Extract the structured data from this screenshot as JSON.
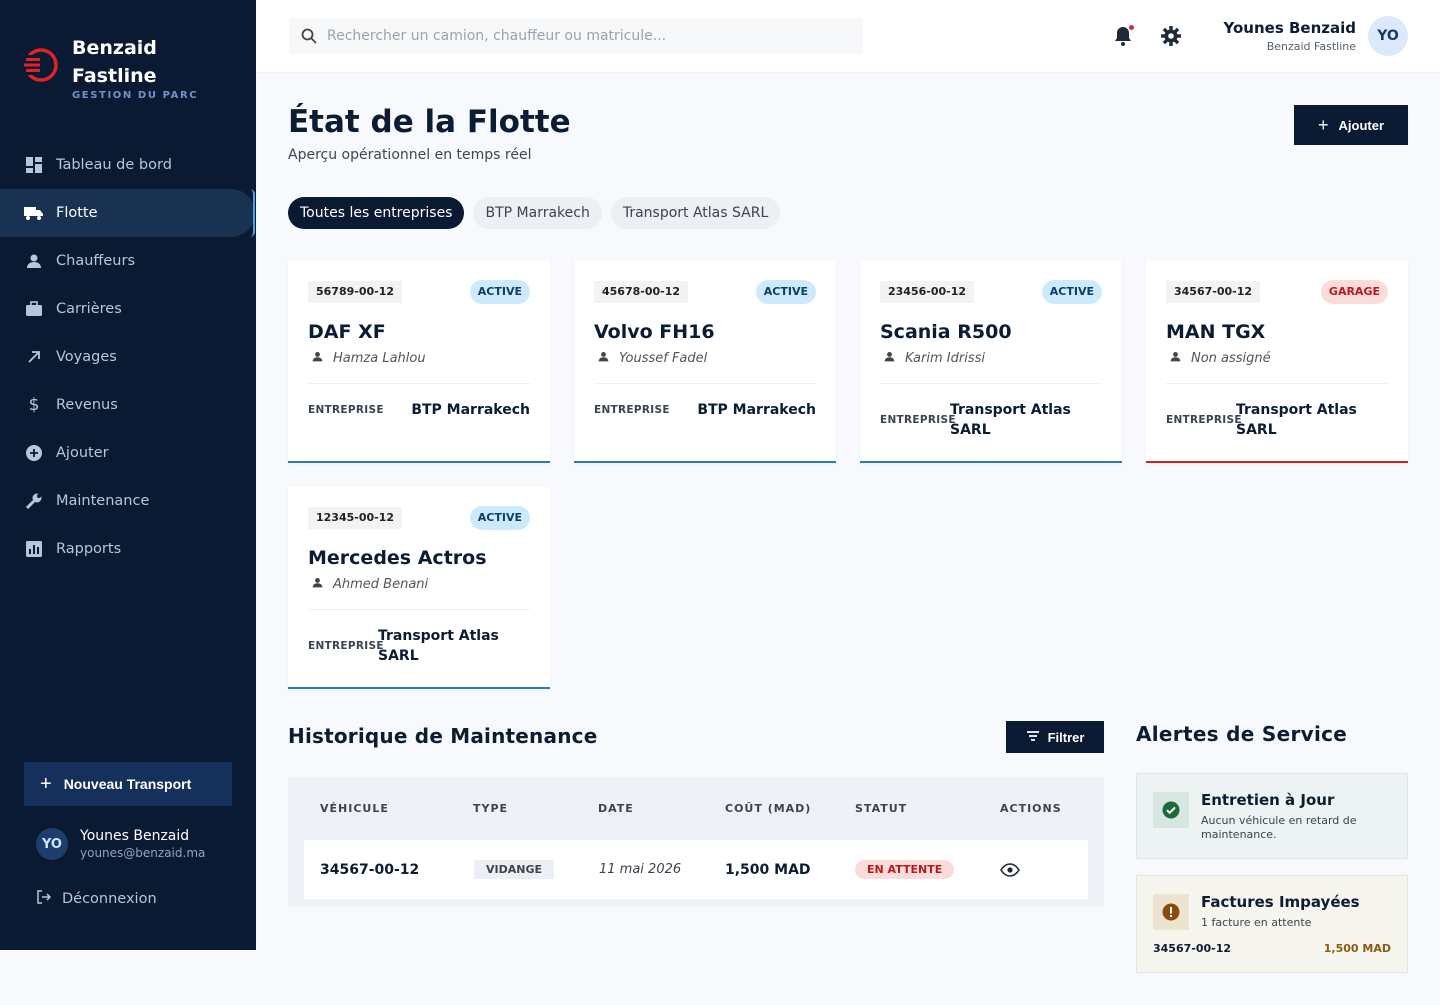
{
  "brand": {
    "name_line1": "Benzaid",
    "name_line2": "Fastline",
    "subtitle": "GESTION DU PARC",
    "accent": "#e02424"
  },
  "sidebar": {
    "items": [
      {
        "label": "Tableau de bord",
        "icon": "dashboard-icon",
        "active": false
      },
      {
        "label": "Flotte",
        "icon": "truck-icon",
        "active": true
      },
      {
        "label": "Chauffeurs",
        "icon": "person-icon",
        "active": false
      },
      {
        "label": "Carrières",
        "icon": "briefcase-icon",
        "active": false
      },
      {
        "label": "Voyages",
        "icon": "arrow-up-right-icon",
        "active": false
      },
      {
        "label": "Revenus",
        "icon": "dollar-icon",
        "active": false
      },
      {
        "label": "Ajouter",
        "icon": "plus-circle-icon",
        "active": false
      },
      {
        "label": "Maintenance",
        "icon": "wrench-icon",
        "active": false
      },
      {
        "label": "Rapports",
        "icon": "bar-chart-icon",
        "active": false
      }
    ],
    "new_transport_label": "Nouveau Transport",
    "user": {
      "initials": "YO",
      "name": "Younes Benzaid",
      "email": "younes@benzaid.ma"
    },
    "logout_label": "Déconnexion"
  },
  "topbar": {
    "search_placeholder": "Rechercher un camion, chauffeur ou matricule...",
    "user": {
      "name": "Younes Benzaid",
      "company": "Benzaid Fastline",
      "initials": "YO"
    }
  },
  "header": {
    "title": "État de la Flotte",
    "subtitle": "Aperçu opérationnel en temps réel",
    "add_label": "Ajouter"
  },
  "filters": [
    {
      "label": "Toutes les entreprises",
      "active": true
    },
    {
      "label": "BTP Marrakech",
      "active": false
    },
    {
      "label": "Transport Atlas SARL",
      "active": false
    }
  ],
  "trucks": [
    {
      "plate": "56789-00-12",
      "status": "ACTIVE",
      "model": "DAF XF",
      "driver": "Hamza Lahlou",
      "company_label": "ENTREPRISE",
      "company_line1": "BTP Marrakech",
      "company_line2": ""
    },
    {
      "plate": "45678-00-12",
      "status": "ACTIVE",
      "model": "Volvo FH16",
      "driver": "Youssef Fadel",
      "company_label": "ENTREPRISE",
      "company_line1": "BTP Marrakech",
      "company_line2": ""
    },
    {
      "plate": "23456-00-12",
      "status": "ACTIVE",
      "model": "Scania R500",
      "driver": "Karim Idrissi",
      "company_label": "ENTREPRISE",
      "company_line1": "Transport Atlas",
      "company_line2": "SARL"
    },
    {
      "plate": "34567-00-12",
      "status": "GARAGE",
      "model": "MAN TGX",
      "driver": "Non assigné",
      "company_label": "ENTREPRISE",
      "company_line1": "Transport Atlas",
      "company_line2": "SARL"
    },
    {
      "plate": "12345-00-12",
      "status": "ACTIVE",
      "model": "Mercedes Actros",
      "driver": "Ahmed Benani",
      "company_label": "ENTREPRISE",
      "company_line1": "Transport Atlas",
      "company_line2": "SARL"
    }
  ],
  "maintenance": {
    "title": "Historique de Maintenance",
    "filter_label": "Filtrer",
    "columns": [
      "VÉHICULE",
      "TYPE",
      "DATE",
      "COÛT (MAD)",
      "STATUT",
      "ACTIONS"
    ],
    "rows": [
      {
        "vehicle": "34567-00-12",
        "type": "VIDANGE",
        "date": "11 mai 2026",
        "cost": "1,500 MAD",
        "status": "EN ATTENTE"
      }
    ]
  },
  "alerts": {
    "title": "Alertes de Service",
    "ok": {
      "title": "Entretien à Jour",
      "body": "Aucun véhicule en retard de maintenance."
    },
    "warn": {
      "title": "Factures Impayées",
      "body": "1 facture en attente",
      "plate": "34567-00-12",
      "amount": "1,500 MAD"
    }
  }
}
